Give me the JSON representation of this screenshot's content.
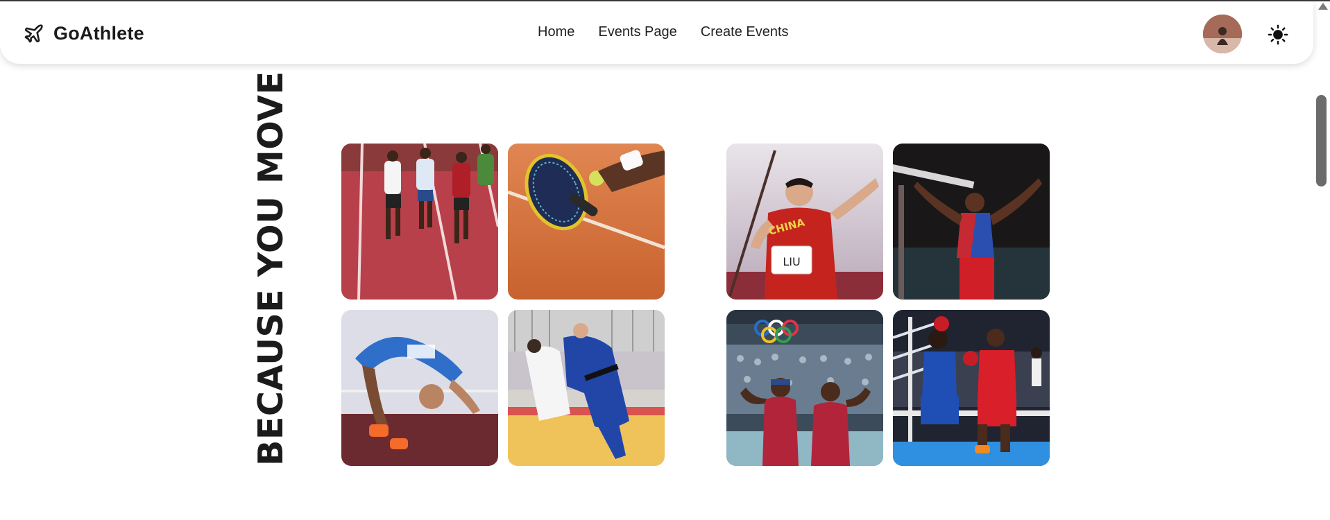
{
  "brand": {
    "name": "GoAthlete",
    "icon": "airplane-icon"
  },
  "nav": {
    "links": [
      {
        "label": "Home"
      },
      {
        "label": "Events Page"
      },
      {
        "label": "Create Events"
      }
    ]
  },
  "header": {
    "avatar_icon": "user-avatar",
    "theme_icon": "sun-icon"
  },
  "hero": {
    "tagline": "BECAUSE YOU MOVE",
    "photos": [
      {
        "subject": "track-runners"
      },
      {
        "subject": "tennis-racket"
      },
      {
        "subject": "javelin-thrower"
      },
      {
        "subject": "gymnast"
      },
      {
        "subject": "high-jumper"
      },
      {
        "subject": "judo"
      },
      {
        "subject": "beach-volleyball-players"
      },
      {
        "subject": "boxing"
      }
    ],
    "bib_text": "LIU",
    "jersey_text": "CHINA"
  },
  "colors": {
    "accent_dark": "#1b1b1b",
    "track_red": "#b8404a",
    "clay_orange": "#d9733f",
    "judo_blue": "#2146a8",
    "boxing_blue": "#2f8fe0"
  }
}
